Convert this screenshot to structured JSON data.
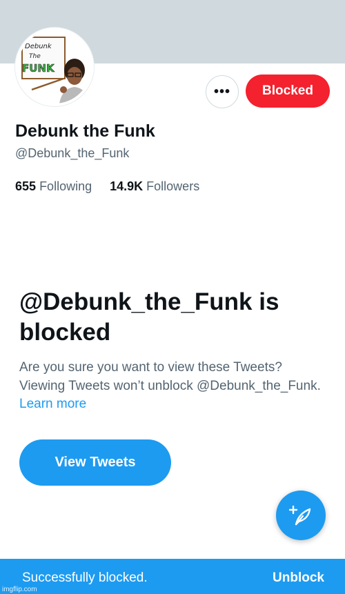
{
  "profile": {
    "avatar_text_line1": "Debunk",
    "avatar_text_line2": "The",
    "avatar_text_line3": "FUNK",
    "display_name": "Debunk the Funk",
    "handle": "@Debunk_the_Funk",
    "more_label": "•••",
    "blocked_label": "Blocked",
    "following_count": "655",
    "following_label": "Following",
    "followers_count": "14.9K",
    "followers_label": "Followers"
  },
  "blocked_notice": {
    "title": "@Debunk_the_Funk is blocked",
    "description": "Are you sure you want to view these Tweets? Viewing Tweets won’t unblock @Debunk_the_Funk.",
    "learn_more": "Learn more",
    "view_button": "View Tweets"
  },
  "fab": {
    "icon": "compose-tweet-icon"
  },
  "toast": {
    "message": "Successfully blocked.",
    "action": "Unblock"
  },
  "watermark": "imgflip.com",
  "colors": {
    "banner": "#cfd9de",
    "blocked_red": "#f4212e",
    "accent_blue": "#1d9bf0",
    "text_primary": "#0f1419",
    "text_secondary": "#536471"
  }
}
